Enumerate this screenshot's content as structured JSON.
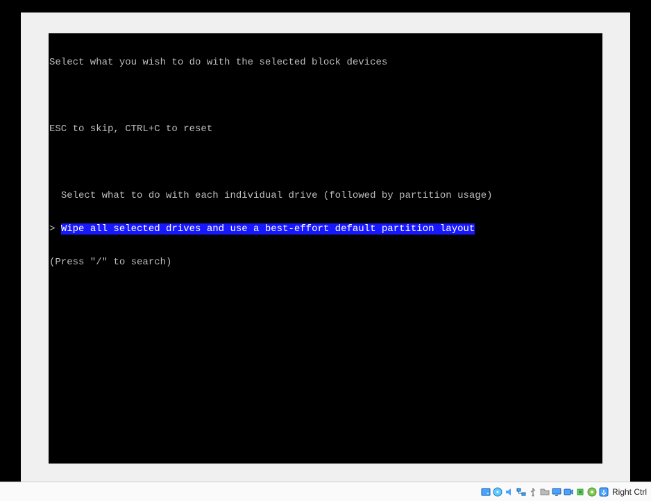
{
  "terminal": {
    "prompt_title": "Select what you wish to do with the selected block devices",
    "hint_line": "ESC to skip, CTRL+C to reset",
    "cursor_prefix": ">",
    "menu": {
      "items": [
        {
          "label": "Select what to do with each individual drive (followed by partition usage)",
          "selected": false
        },
        {
          "label": "Wipe all selected drives and use a best-effort default partition layout",
          "selected": true
        }
      ]
    },
    "search_hint": "(Press \"/\" to search)"
  },
  "statusbar": {
    "host_key_label": "Right Ctrl",
    "icons": [
      "harddisk-icon",
      "optical-disc-icon",
      "audio-icon",
      "network-icon",
      "usb-icon",
      "shared-folder-icon",
      "display-icon",
      "recording-icon",
      "cpu-icon",
      "mouse-integration-icon",
      "keyboard-capture-icon"
    ]
  }
}
